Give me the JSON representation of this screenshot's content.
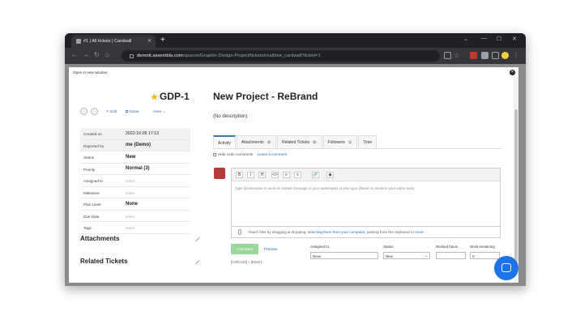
{
  "browser": {
    "tab_title": "#1 | All tickets | Cardwall",
    "url_host": "demott.assembla.com",
    "url_path": "/spaces/Graphic-Design-Project/tickets/realtime_cardwall?ticket=1"
  },
  "modal": {
    "open_new_window": "Open in new window",
    "ticket_id": "GDP-1",
    "actions": {
      "edit": "Edit",
      "clone": "Clone",
      "more": "more"
    }
  },
  "meta": [
    {
      "key": "Created on",
      "value": "2022-10-05 17:13",
      "style": "normal",
      "shaded": true
    },
    {
      "key": "Reported by",
      "value": "me (Demo)",
      "style": "bold",
      "shaded": true
    },
    {
      "key": "Status",
      "value": "New",
      "style": "bold",
      "shaded": false
    },
    {
      "key": "Priority",
      "value": "Normal (3)",
      "style": "bold",
      "shaded": false
    },
    {
      "key": "Assigned to",
      "value": "select",
      "style": "muted",
      "shaded": false
    },
    {
      "key": "Milestone",
      "value": "select",
      "style": "muted",
      "shaded": false
    },
    {
      "key": "Plan Level",
      "value": "None",
      "style": "bold",
      "shaded": false
    },
    {
      "key": "Due Date",
      "value": "select",
      "style": "muted",
      "shaded": false
    },
    {
      "key": "Tags",
      "value": "select",
      "style": "muted",
      "shaded": false
    }
  ],
  "sections": {
    "attachments": "Attachments",
    "related": "Related Tickets"
  },
  "ticket": {
    "title": "New Project - ReBrand",
    "description": "(No description)"
  },
  "tabs": [
    {
      "label": "Activity",
      "count": "",
      "active": true
    },
    {
      "label": "Attachments",
      "count": "0",
      "active": false
    },
    {
      "label": "Related Tickets",
      "count": "0",
      "active": false
    },
    {
      "label": "Followers",
      "count": "1",
      "active": false
    },
    {
      "label": "Time",
      "count": "",
      "active": false
    }
  ],
  "activity": {
    "hide_code_comments": "Hide code comments",
    "leave_comment": "Leave a comment"
  },
  "editor": {
    "toolbar": [
      "B",
      "I",
      "H",
      "</>",
      "≡",
      "≡",
      "🔗",
      "◉"
    ],
    "placeholder": "Type @username to send an instant message to your teammates or else type @team to mention your entire team"
  },
  "attach": {
    "text": "Attach files by dragging & dropping,",
    "link": "selecting them from your computer",
    "tail": ", pasting from the clipboard or",
    "more": "more"
  },
  "footer": {
    "comment": "Comment",
    "preview": "Preview",
    "hint": "[Ctrl/Cmd] + [Enter]",
    "assigned_label": "Assigned to",
    "assigned_value": "None",
    "status_label": "Status",
    "status_value": "New",
    "worked_label": "Worked hours",
    "remaining_label": "Work remaining",
    "remaining_value": "0"
  }
}
